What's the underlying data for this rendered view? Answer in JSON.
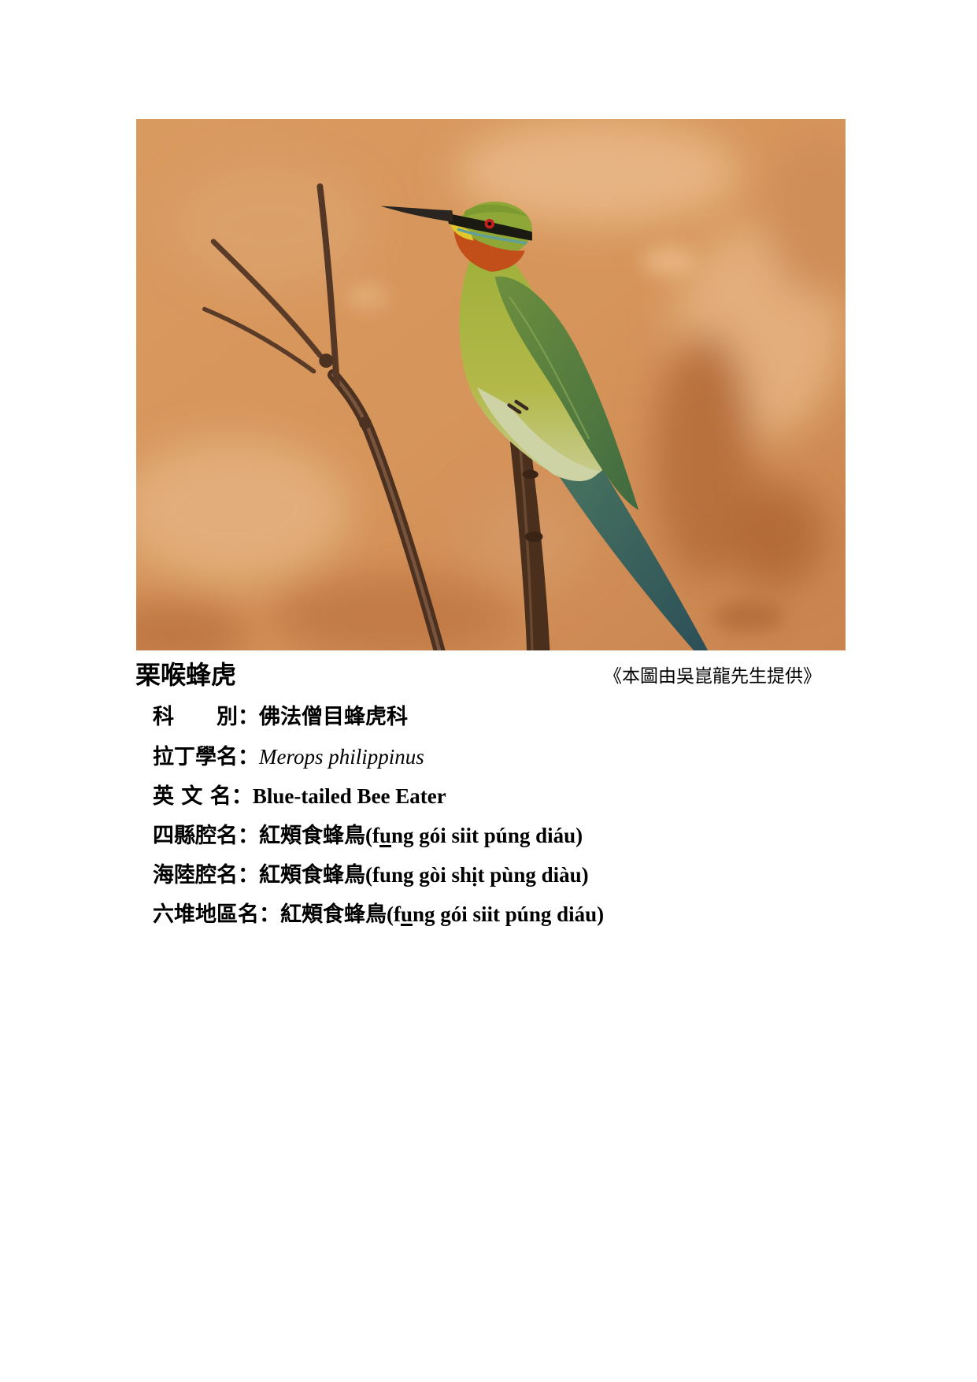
{
  "title": "栗喉蜂虎",
  "credit": "《本圖由吳崑龍先生提供》",
  "separator": "：",
  "fields": [
    {
      "label": "科　　別",
      "value": "佛法僧目蜂虎科"
    },
    {
      "label": "拉丁學名",
      "value": "Merops philippinus"
    },
    {
      "label": "英 文 名",
      "value": "Blue-tailed Bee Eater"
    },
    {
      "label": "四縣腔名",
      "value_han": "紅頰食蜂鳥",
      "rom_before": "(f",
      "rom_underlined": "u",
      "rom_after": "ng gói siit púng diáu)"
    },
    {
      "label": "海陸腔名",
      "value_han": "紅頰食蜂鳥",
      "rom": "(fung gòi shịt pùng diàu)"
    },
    {
      "label": "六堆地區名",
      "value_han": "紅頰食蜂鳥",
      "rom_before": "(f",
      "rom_underlined": "u",
      "rom_after": "ng gói siit púng diáu)"
    }
  ],
  "colors": {
    "text": "#000000",
    "page_background": "#ffffff"
  }
}
